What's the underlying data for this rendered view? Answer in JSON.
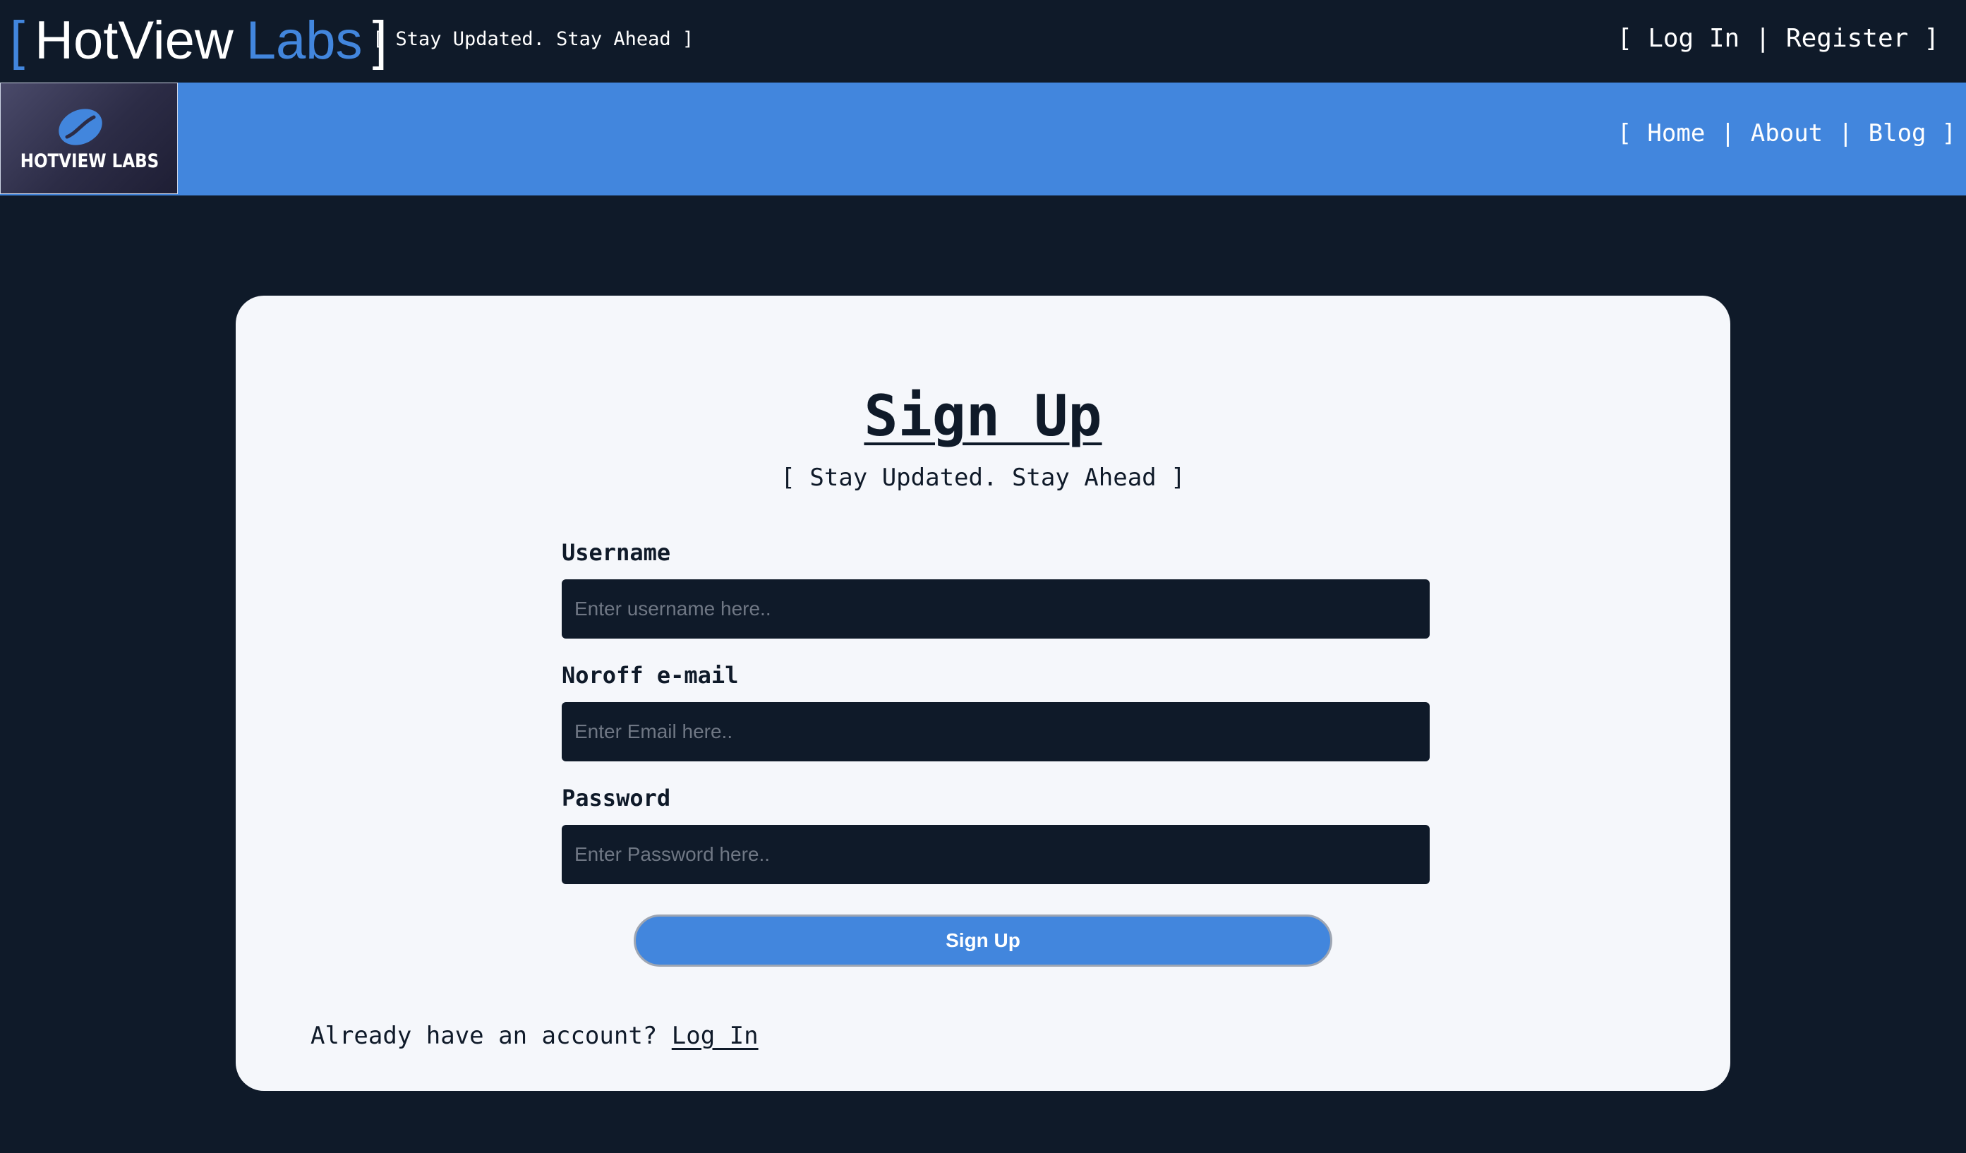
{
  "header": {
    "brand": {
      "bracket_open": "[",
      "name_part1": "HotView",
      "name_part2": "Labs",
      "bracket_close": "]"
    },
    "tagline": "[ Stay Updated. Stay Ahead ]",
    "auth": {
      "open": "[",
      "login": "Log In",
      "separator": "|",
      "register": "Register",
      "close": "]"
    }
  },
  "nav": {
    "logo_text": "HOTVIEW LABS",
    "open": "[",
    "home": "Home",
    "sep1": "|",
    "about": "About",
    "sep2": "|",
    "blog": "Blog",
    "close": "]"
  },
  "form": {
    "title": "Sign Up",
    "tagline": "[ Stay Updated. Stay Ahead ]",
    "username_label": "Username",
    "username_placeholder": "Enter username here..",
    "email_label": "Noroff e-mail",
    "email_placeholder": "Enter Email here..",
    "password_label": "Password",
    "password_placeholder": "Enter Password here..",
    "submit_label": "Sign Up",
    "already_text": "Already have an account?",
    "login_link": "Log In"
  },
  "colors": {
    "background": "#0f1a29",
    "accent": "#4286dd",
    "card": "#f5f7fb"
  },
  "icons": {
    "logo": "coffee-bean-icon"
  }
}
